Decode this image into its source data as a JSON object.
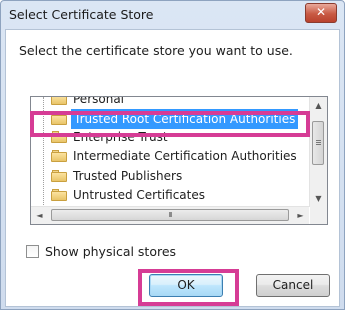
{
  "window": {
    "title": "Select Certificate Store",
    "close_label": "✕"
  },
  "prompt": "Select the certificate store you want to use.",
  "tree": {
    "items": [
      {
        "label": "Personal",
        "selected": false
      },
      {
        "label": "Trusted Root Certification Authorities",
        "selected": true
      },
      {
        "label": "Enterprise Trust",
        "selected": false
      },
      {
        "label": "Intermediate Certification Authorities",
        "selected": false
      },
      {
        "label": "Trusted Publishers",
        "selected": false
      },
      {
        "label": "Untrusted Certificates",
        "selected": false
      }
    ]
  },
  "scrollbars": {
    "up": "▲",
    "down": "▼",
    "left": "◄",
    "right": "►",
    "thumb_grip": "III"
  },
  "show_physical_stores": {
    "label": "Show physical stores",
    "checked": false
  },
  "buttons": {
    "ok": "OK",
    "cancel": "Cancel"
  },
  "colors": {
    "highlight": "#d63c95",
    "selection": "#3399ff",
    "title_close": "#c85a44"
  }
}
